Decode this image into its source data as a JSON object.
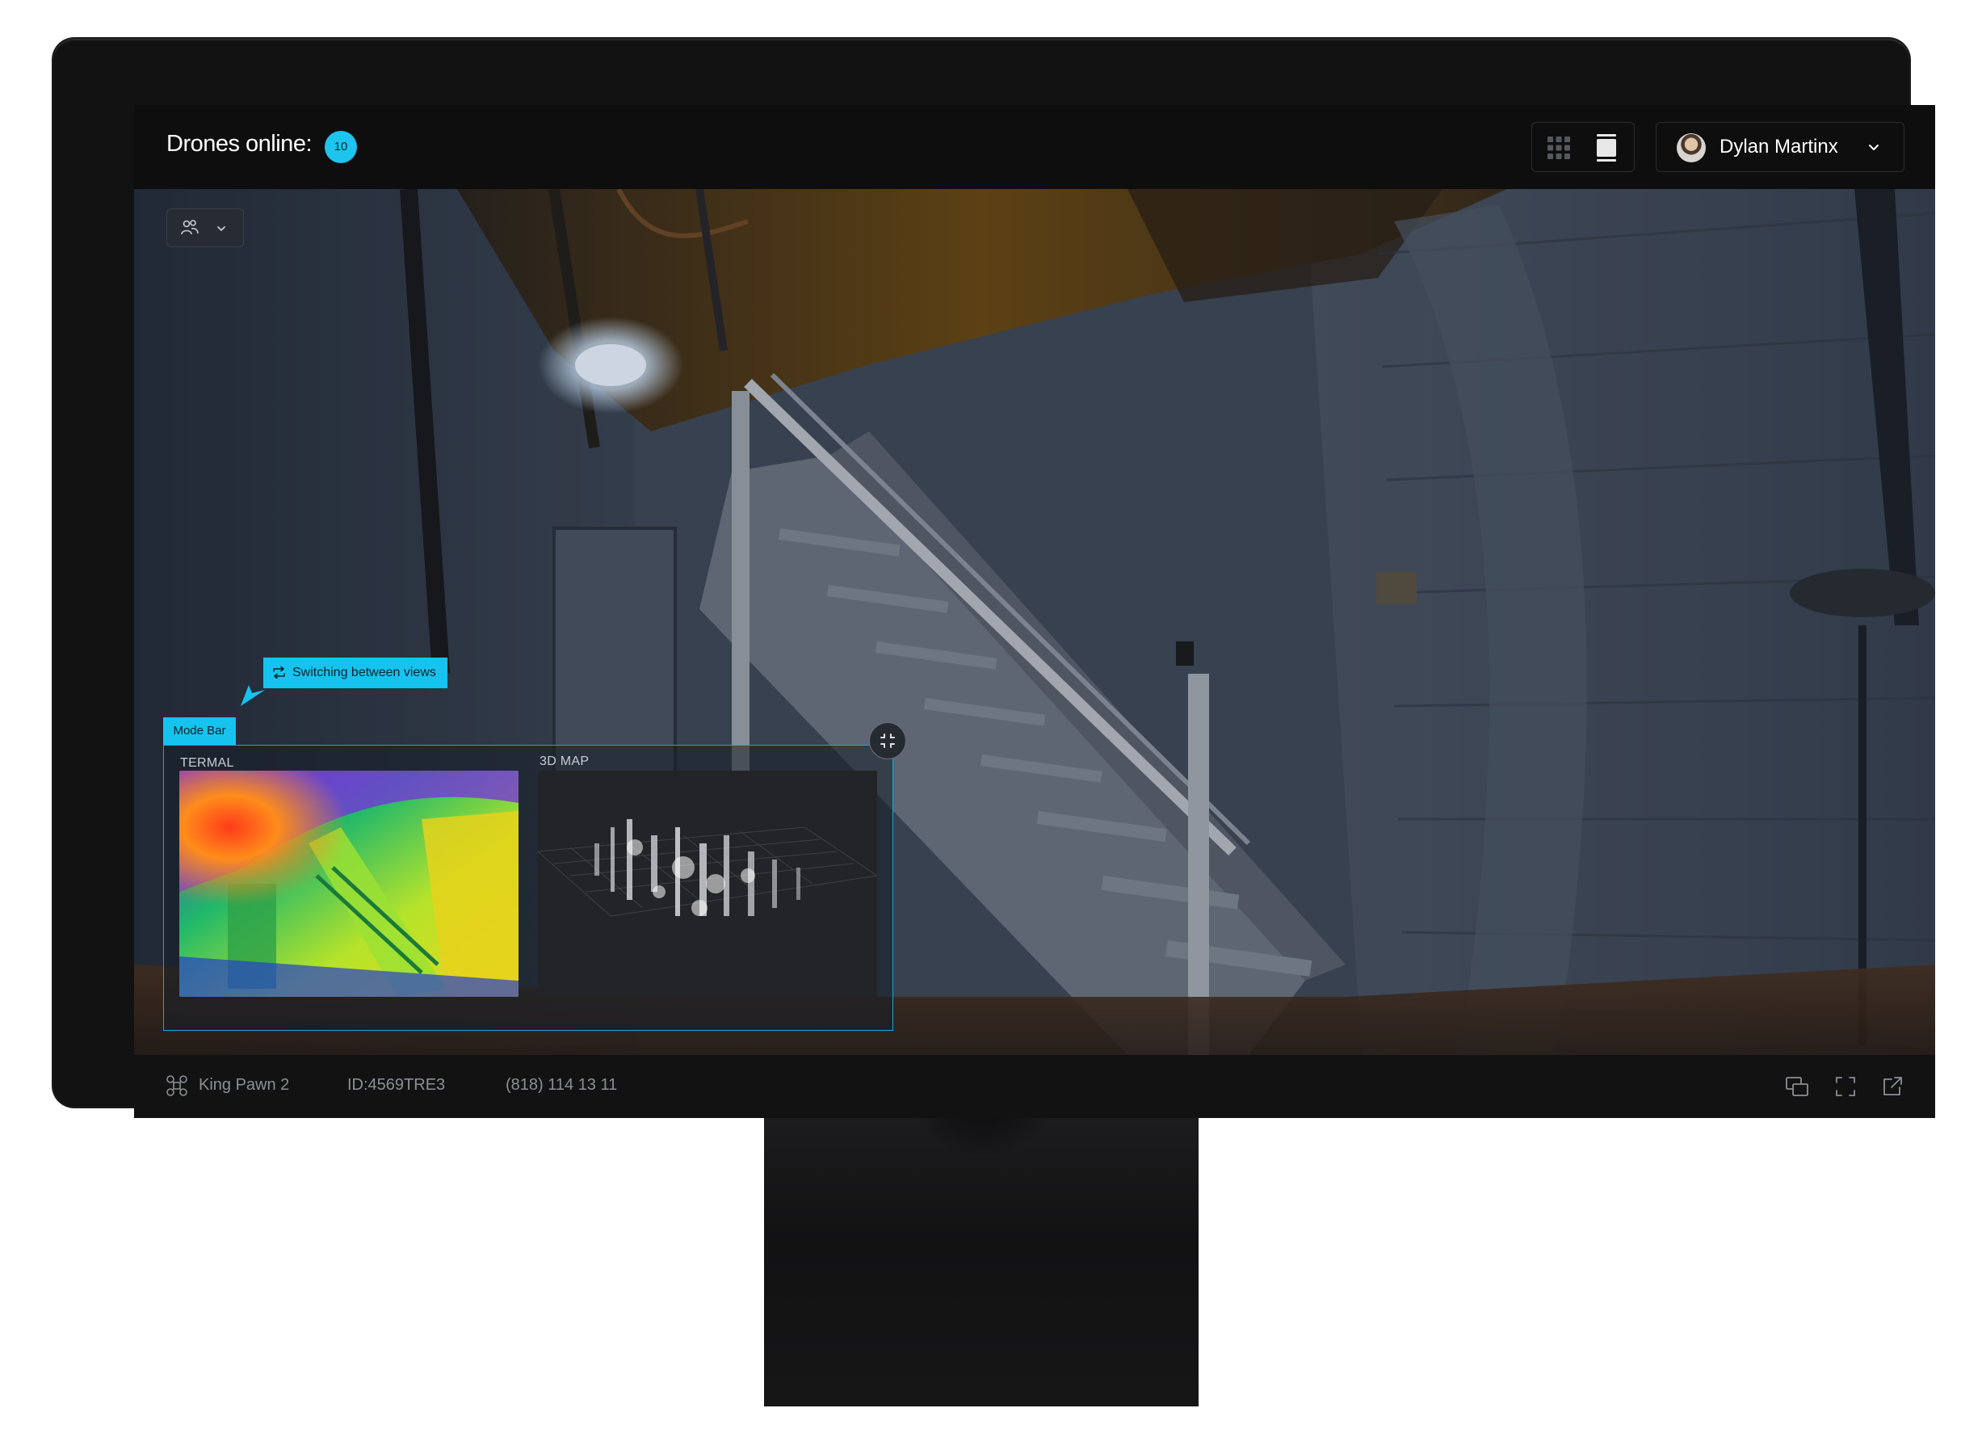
{
  "header": {
    "drones_online_label": "Drones online:",
    "drones_online_count": "10",
    "user_name": "Dylan Martinx"
  },
  "annotations": {
    "switching_label": "Switching between views",
    "mode_bar_label": "Mode Bar"
  },
  "mode_bar": {
    "views": [
      {
        "label": "TERMAL"
      },
      {
        "label": "3D MAP"
      }
    ]
  },
  "footer": {
    "drone_name": "King Pawn 2",
    "drone_id": "ID:4569TRE3",
    "phone": "(818) 114 13 11"
  },
  "icons": {
    "grid_view": "grid-icon",
    "list_view": "list-icon",
    "user_chevron": "chevron-down-icon",
    "group_select": "users-icon",
    "collapse": "collapse-icon",
    "drone": "drone-icon",
    "picture_in_picture": "screens-icon",
    "fullscreen": "fullscreen-icon",
    "external": "external-link-icon"
  },
  "colors": {
    "accent": "#16c3ef",
    "screen_bg": "#0e0e0f",
    "muted_text": "#8c8f94"
  }
}
